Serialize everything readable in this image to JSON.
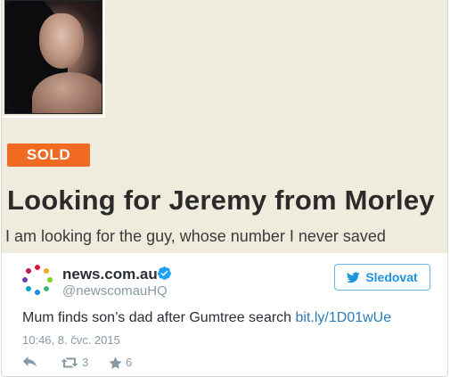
{
  "ad": {
    "badge": "SOLD",
    "title": "Looking for Jeremy from Morley",
    "body": "I am looking for the guy, whose number I never saved"
  },
  "tweet": {
    "display_name": "news.com.au",
    "handle": "@newscomauHQ",
    "follow_label": "Sledovat",
    "text": "Mum finds son’s dad after Gumtree search ",
    "link": "bit.ly/1D01wUe",
    "timestamp": "10:46, 8. čvc. 2015",
    "retweet_count": "3",
    "like_count": "6"
  },
  "icons": {
    "verified": "verified-badge-icon",
    "follow": "twitter-bird-icon",
    "reply": "reply-icon",
    "retweet": "retweet-icon",
    "like": "star-icon"
  },
  "colors": {
    "badge": "#f06b21",
    "link": "#2b7bb9",
    "follow": "#1b95e0",
    "muted": "#8899a6"
  }
}
